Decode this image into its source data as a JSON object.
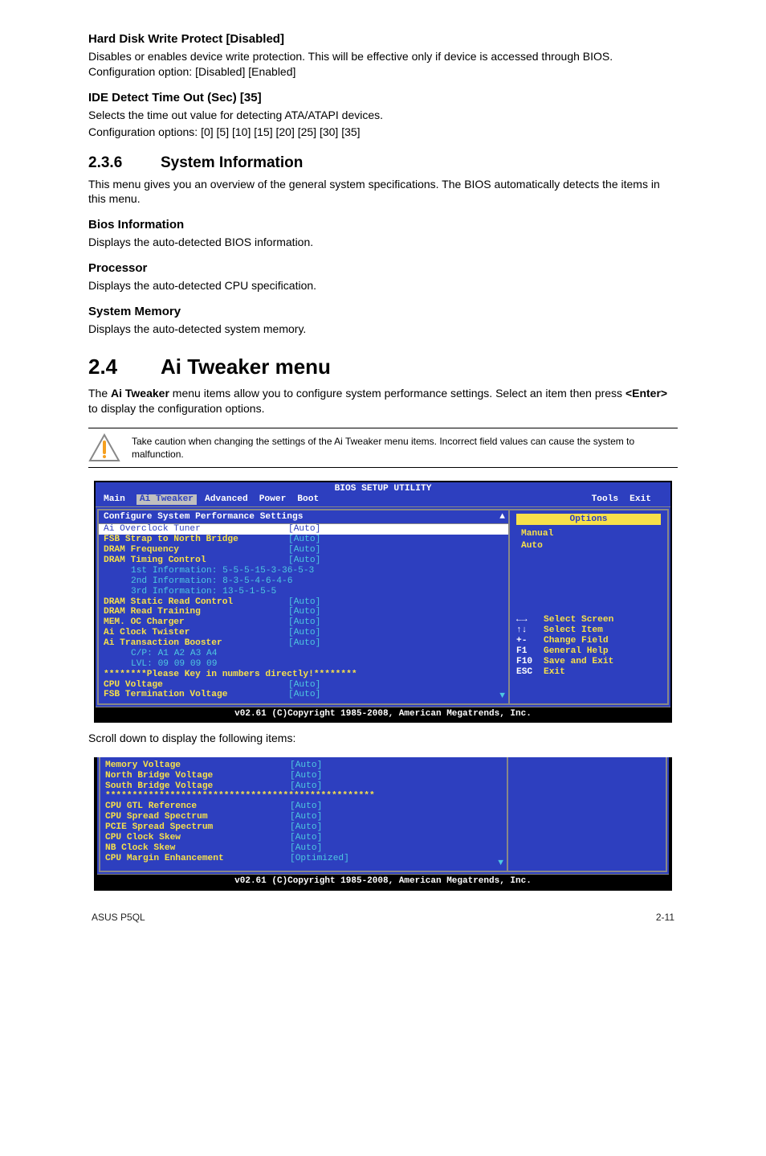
{
  "doc": {
    "h_hdwp": "Hard Disk Write Protect [Disabled]",
    "p_hdwp": "Disables or enables device write protection. This will be effective only if device is accessed through BIOS. Configuration option: [Disabled] [Enabled]",
    "h_ide": "IDE Detect Time Out (Sec) [35]",
    "p_ide1": "Selects the time out value for detecting ATA/ATAPI devices.",
    "p_ide2": "Configuration options: [0] [5] [10] [15] [20] [25] [30] [35]",
    "sec236_num": "2.3.6",
    "sec236_title": "System Information",
    "p_236": "This menu gives you an overview of the general system specifications. The BIOS automatically detects the items in this menu.",
    "h_bios": "Bios Information",
    "p_bios": "Displays the auto-detected BIOS information.",
    "h_proc": "Processor",
    "p_proc": "Displays the auto-detected CPU specification.",
    "h_mem": "System Memory",
    "p_mem": "Displays the auto-detected system memory.",
    "sec24_num": "2.4",
    "sec24_title": "Ai Tweaker menu",
    "p_24a": "The ",
    "p_24b": "Ai Tweaker",
    "p_24c": " menu items allow you to configure system performance settings. Select an item then press ",
    "p_24d": "<Enter>",
    "p_24e": " to display the configuration options.",
    "notice": "Take caution when changing the settings of the Ai Tweaker menu items. Incorrect field values can cause the system to malfunction.",
    "scroll_intro": "Scroll down to display the following items:"
  },
  "bios1": {
    "title": "BIOS SETUP UTILITY",
    "menu": {
      "main": "Main",
      "aitweaker": "Ai Tweaker",
      "advanced": "Advanced",
      "power": "Power",
      "boot": "Boot",
      "tools": "Tools",
      "exit": "Exit"
    },
    "section": "Configure System Performance Settings",
    "rows": [
      {
        "k": "Ai Overclock Tuner",
        "v": "[Auto]",
        "sel": true
      },
      {
        "k": "FSB Strap to North Bridge",
        "v": "[Auto]"
      },
      {
        "k": "DRAM Frequency",
        "v": "[Auto]"
      },
      {
        "k": "DRAM Timing Control",
        "v": "[Auto]"
      }
    ],
    "info": [
      "1st Information: 5-5-5-15-3-36-5-3",
      "2nd Information: 8-3-5-4-6-4-6",
      "3rd Information: 13-5-1-5-5"
    ],
    "rows2": [
      {
        "k": "DRAM Static Read Control",
        "v": "[Auto]"
      },
      {
        "k": "DRAM Read Training",
        "v": "[Auto]"
      },
      {
        "k": "MEM. OC Charger",
        "v": "[Auto]"
      },
      {
        "k": "Ai Clock Twister",
        "v": "[Auto]"
      },
      {
        "k": "Ai Transaction Booster",
        "v": "[Auto]"
      }
    ],
    "sub": [
      "C/P: A1 A2 A3 A4",
      "LVL: 09 09 09 09"
    ],
    "stars": "********Please Key in numbers directly!********",
    "rows3": [
      {
        "k": "CPU Voltage",
        "v": "[Auto]"
      },
      {
        "k": "FSB Termination Voltage",
        "v": "[Auto]"
      }
    ],
    "rightbox_title": "Options",
    "right_manual": "Manual",
    "right_auto": "Auto",
    "hints": [
      {
        "icon": "←→",
        "txt": "Select Screen"
      },
      {
        "icon": "↑↓",
        "txt": "Select Item"
      },
      {
        "icon": "+-",
        "txt": "Change Field"
      },
      {
        "icon": "F1",
        "txt": "General Help"
      },
      {
        "icon": "F10",
        "txt": "Save and Exit"
      },
      {
        "icon": "ESC",
        "txt": "Exit"
      }
    ],
    "footer": "v02.61 (C)Copyright 1985-2008, American Megatrends, Inc."
  },
  "bios2": {
    "rows1": [
      {
        "k": "Memory Voltage",
        "v": "[Auto]"
      },
      {
        "k": "North Bridge Voltage",
        "v": "[Auto]"
      },
      {
        "k": "South Bridge Voltage",
        "v": "[Auto]"
      }
    ],
    "stars": "**************************************************",
    "rows2": [
      {
        "k": "CPU GTL Reference",
        "v": "[Auto]"
      },
      {
        "k": "CPU Spread Spectrum",
        "v": "[Auto]"
      },
      {
        "k": "PCIE Spread Spectrum",
        "v": "[Auto]"
      },
      {
        "k": "CPU Clock Skew",
        "v": "[Auto]"
      },
      {
        "k": "NB Clock Skew",
        "v": "[Auto]"
      },
      {
        "k": "CPU Margin Enhancement",
        "v": "[Optimized]"
      }
    ],
    "footer": "v02.61 (C)Copyright 1985-2008, American Megatrends, Inc."
  },
  "footer": {
    "left": "ASUS P5QL",
    "right": "2-11"
  }
}
